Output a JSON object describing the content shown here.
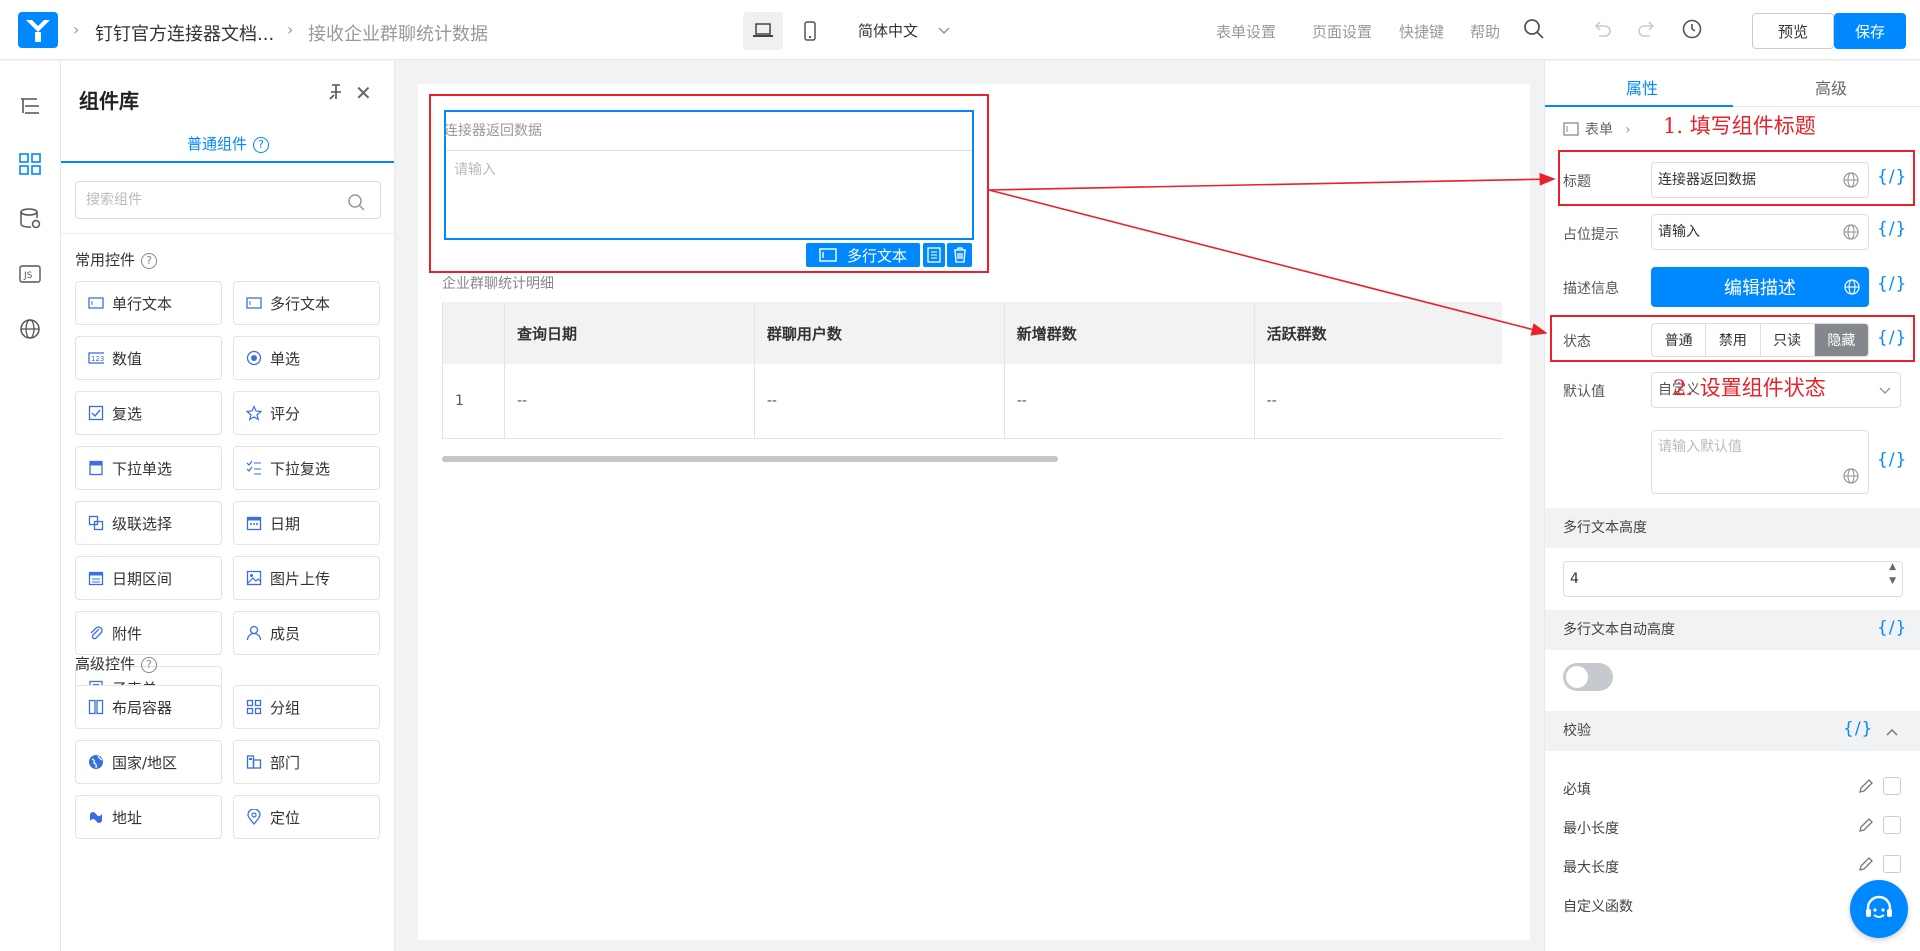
{
  "header": {
    "breadcrumb": [
      "钉钉官方连接器文档...",
      "接收企业群聊统计数据"
    ],
    "language": "简体中文",
    "links": [
      "表单设置",
      "页面设置",
      "快捷键",
      "帮助"
    ],
    "preview_label": "预览",
    "save_label": "保存"
  },
  "library": {
    "title": "组件库",
    "tab": "普通组件",
    "search_placeholder": "搜索组件",
    "common_title": "常用控件",
    "common": [
      {
        "label": "单行文本",
        "icon": "single-line-icon"
      },
      {
        "label": "多行文本",
        "icon": "multi-line-icon"
      },
      {
        "label": "数值",
        "icon": "number-icon"
      },
      {
        "label": "单选",
        "icon": "radio-icon"
      },
      {
        "label": "复选",
        "icon": "checkbox-icon"
      },
      {
        "label": "评分",
        "icon": "star-icon"
      },
      {
        "label": "下拉单选",
        "icon": "dropdown-icon"
      },
      {
        "label": "下拉复选",
        "icon": "multi-dropdown-icon"
      },
      {
        "label": "级联选择",
        "icon": "cascade-icon"
      },
      {
        "label": "日期",
        "icon": "calendar-icon"
      },
      {
        "label": "日期区间",
        "icon": "date-range-icon"
      },
      {
        "label": "图片上传",
        "icon": "image-icon"
      },
      {
        "label": "附件",
        "icon": "paperclip-icon"
      },
      {
        "label": "成员",
        "icon": "user-icon"
      },
      {
        "label": "子表单",
        "icon": "subform-icon"
      }
    ],
    "advanced_title": "高级控件",
    "advanced": [
      {
        "label": "布局容器",
        "icon": "layout-icon"
      },
      {
        "label": "分组",
        "icon": "group-icon"
      },
      {
        "label": "国家/地区",
        "icon": "globe-icon"
      },
      {
        "label": "部门",
        "icon": "department-icon"
      },
      {
        "label": "地址",
        "icon": "address-icon"
      },
      {
        "label": "定位",
        "icon": "location-icon"
      }
    ]
  },
  "canvas": {
    "field_label": "连接器返回数据",
    "field_placeholder": "请输入",
    "field_type_badge": "多行文本",
    "table_title": "企业群聊统计明细",
    "table_headers": [
      "",
      "查询日期",
      "群聊用户数",
      "新增群数",
      "活跃群数"
    ],
    "table_rows": [
      [
        "1",
        "--",
        "--",
        "--",
        "--"
      ]
    ]
  },
  "props": {
    "tabs": [
      "属性",
      "高级"
    ],
    "breadcrumb": "表单",
    "rows": {
      "title_label": "标题",
      "title_value": "连接器返回数据",
      "placeholder_label": "占位提示",
      "placeholder_value": "请输入",
      "desc_label": "描述信息",
      "desc_button": "编辑描述",
      "status_label": "状态",
      "status_options": [
        "普通",
        "禁用",
        "只读",
        "隐藏"
      ],
      "default_label": "默认值",
      "default_select": "自定义",
      "default_placeholder": "请输入默认值"
    },
    "height_section": "多行文本高度",
    "height_value": "4",
    "auto_height_section": "多行文本自动高度",
    "validation_section": "校验",
    "validations": [
      "必填",
      "最小长度",
      "最大长度",
      "自定义函数"
    ],
    "fx_label": "{/}"
  },
  "annotations": {
    "note1": "1. 填写组件标题",
    "note2": "2. 设置组件状态"
  },
  "colors": {
    "accent": "#0089ff",
    "annotation_red": "#e8212a"
  }
}
